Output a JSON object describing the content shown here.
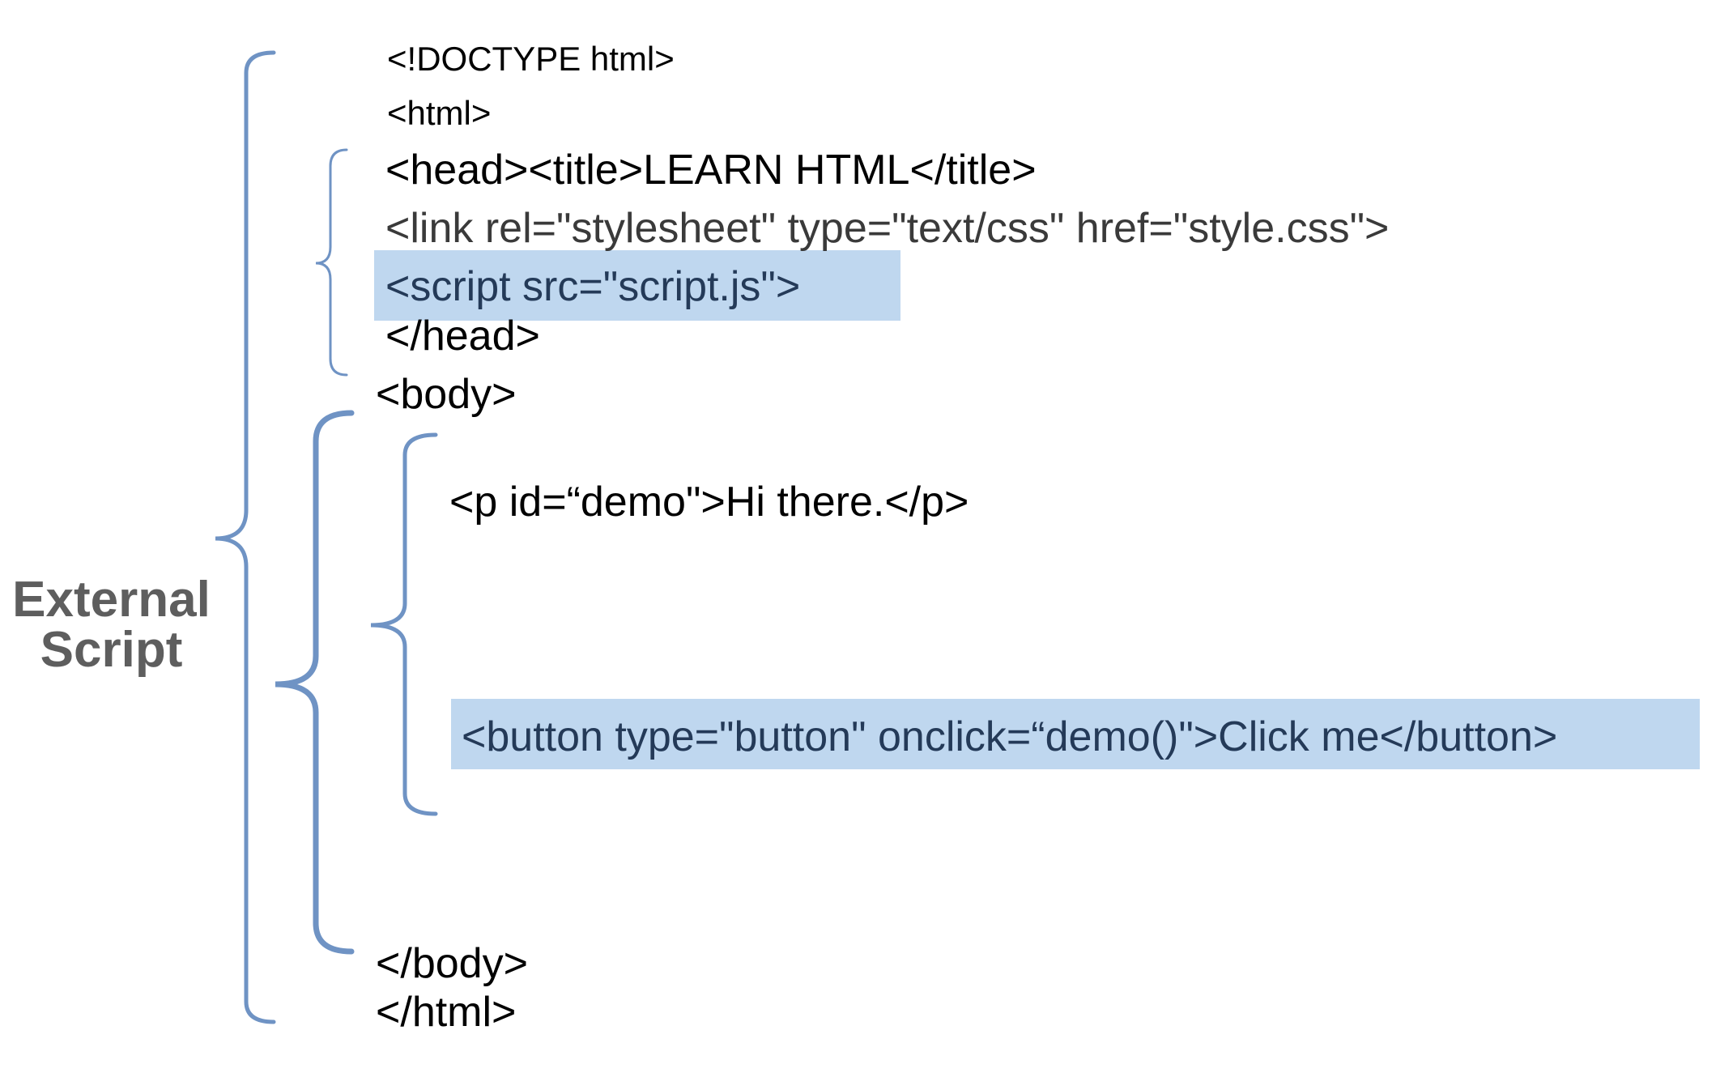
{
  "label": {
    "line1": "External",
    "line2": "Script"
  },
  "code_lines": {
    "doctype": "<!DOCTYPE html>",
    "html_open": "<html>",
    "head_title": "<head><title>LEARN HTML</title>",
    "link_tag": "<link rel=\"stylesheet\" type=\"text/css\" href=\"style.css\">",
    "script_tag": "<script src=\"script.js\">",
    "head_close": "</head>",
    "body_open": "<body>",
    "p_tag": "<p id=“demo\">Hi there.</p>",
    "button_tag": "<button type=\"button\" onclick=“demo()\">Click me</button>",
    "body_close": "</body>",
    "html_close": "</html>"
  },
  "colors": {
    "brace": "#6f93c4",
    "highlight": "#bfd7ef",
    "label": "#5e5e5e",
    "link_text": "#3a3a3a",
    "highlight_text": "#243a58"
  }
}
